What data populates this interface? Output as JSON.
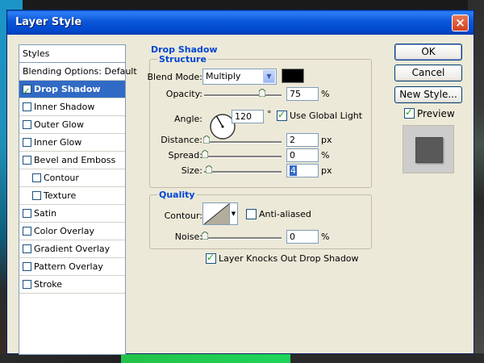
{
  "window": {
    "title": "Layer Style",
    "close_glyph": "×"
  },
  "styles_panel": {
    "header": "Styles",
    "items": [
      {
        "label": "Blending Options: Default",
        "checkbox": false,
        "checked": false,
        "selected": false,
        "sub": false
      },
      {
        "label": "Drop Shadow",
        "checkbox": true,
        "checked": true,
        "selected": true,
        "sub": false
      },
      {
        "label": "Inner Shadow",
        "checkbox": true,
        "checked": false,
        "selected": false,
        "sub": false
      },
      {
        "label": "Outer Glow",
        "checkbox": true,
        "checked": false,
        "selected": false,
        "sub": false
      },
      {
        "label": "Inner Glow",
        "checkbox": true,
        "checked": false,
        "selected": false,
        "sub": false
      },
      {
        "label": "Bevel and Emboss",
        "checkbox": true,
        "checked": false,
        "selected": false,
        "sub": false
      },
      {
        "label": "Contour",
        "checkbox": true,
        "checked": false,
        "selected": false,
        "sub": true
      },
      {
        "label": "Texture",
        "checkbox": true,
        "checked": false,
        "selected": false,
        "sub": true
      },
      {
        "label": "Satin",
        "checkbox": true,
        "checked": false,
        "selected": false,
        "sub": false
      },
      {
        "label": "Color Overlay",
        "checkbox": true,
        "checked": false,
        "selected": false,
        "sub": false
      },
      {
        "label": "Gradient Overlay",
        "checkbox": true,
        "checked": false,
        "selected": false,
        "sub": false
      },
      {
        "label": "Pattern Overlay",
        "checkbox": true,
        "checked": false,
        "selected": false,
        "sub": false
      },
      {
        "label": "Stroke",
        "checkbox": true,
        "checked": false,
        "selected": false,
        "sub": false
      }
    ]
  },
  "drop_shadow": {
    "title": "Drop Shadow",
    "structure": {
      "title": "Structure",
      "blend_mode_label": "Blend Mode:",
      "blend_mode_value": "Multiply",
      "blend_color": "#000000",
      "opacity_label": "Opacity:",
      "opacity_value": "75",
      "opacity_unit": "%",
      "opacity_fraction": 0.75,
      "angle_label": "Angle:",
      "angle_value": "120",
      "angle_unit": "°",
      "use_global_light_label": "Use Global Light",
      "use_global_light_checked": true,
      "distance_label": "Distance:",
      "distance_value": "2",
      "distance_unit": "px",
      "spread_label": "Spread:",
      "spread_value": "0",
      "spread_unit": "%",
      "size_label": "Size:",
      "size_value": "4",
      "size_unit": "px"
    },
    "quality": {
      "title": "Quality",
      "contour_label": "Contour:",
      "anti_aliased_label": "Anti-aliased",
      "anti_aliased_checked": false,
      "noise_label": "Noise:",
      "noise_value": "0",
      "noise_unit": "%"
    },
    "knocks_out_label": "Layer Knocks Out Drop Shadow",
    "knocks_out_checked": true
  },
  "buttons": {
    "ok": "OK",
    "cancel": "Cancel",
    "new_style": "New Style...",
    "preview_label": "Preview",
    "preview_checked": true
  }
}
